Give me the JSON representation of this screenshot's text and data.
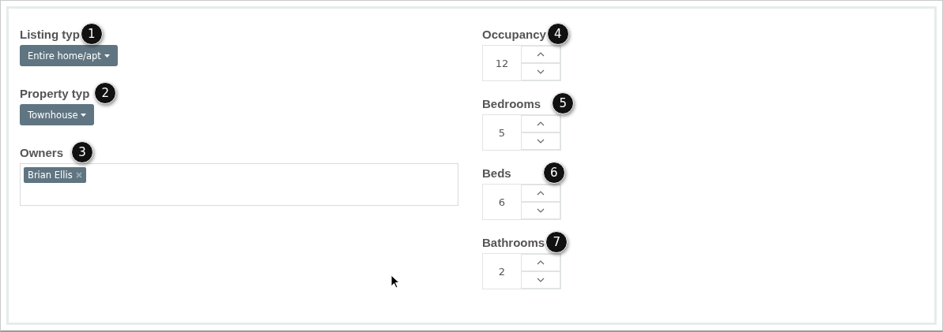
{
  "left_fields": [
    {
      "kind": "dropdown",
      "label": "Listing typ",
      "badge": "1",
      "value": "Entire home/apt"
    },
    {
      "kind": "dropdown",
      "label": "Property typ",
      "badge": "2",
      "value": "Townhouse"
    },
    {
      "kind": "tags",
      "label": "Owners",
      "badge": "3",
      "tags": [
        "Brian Ellis"
      ]
    }
  ],
  "right_fields": [
    {
      "label": "Occupancy",
      "badge": "4",
      "value": "12"
    },
    {
      "label": "Bedrooms",
      "badge": "5",
      "value": "5"
    },
    {
      "label": "Beds",
      "badge": "6",
      "value": "6"
    },
    {
      "label": "Bathrooms",
      "badge": "7",
      "value": "2"
    }
  ]
}
